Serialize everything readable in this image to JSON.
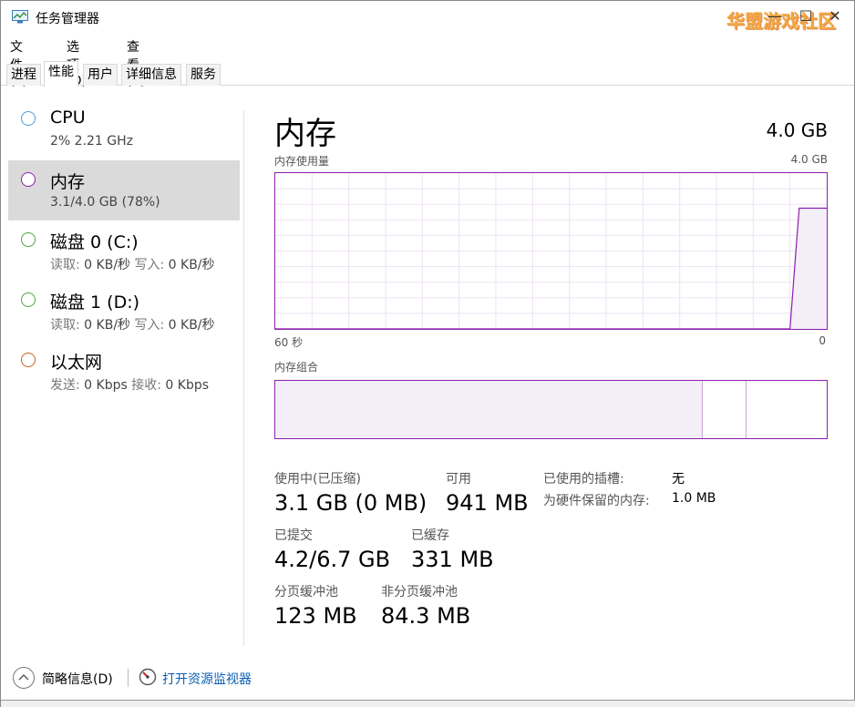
{
  "window": {
    "title": "任务管理器",
    "watermark": "华盟游戏社区",
    "controls": {
      "minimize": "—",
      "maximize": "☐",
      "close": "✕"
    }
  },
  "menu": [
    "文件(F)",
    "选项(O)",
    "查看(V)"
  ],
  "tabs": [
    {
      "label": "进程",
      "active": false
    },
    {
      "label": "性能",
      "active": true
    },
    {
      "label": "用户",
      "active": false
    },
    {
      "label": "详细信息",
      "active": false
    },
    {
      "label": "服务",
      "active": false
    }
  ],
  "resources": [
    {
      "name": "CPU",
      "sub": "2%  2.21 GHz",
      "color": "#4a9ad4",
      "selected": false
    },
    {
      "name": "内存",
      "sub": "3.1/4.0 GB (78%)",
      "color": "#8b1fae",
      "selected": true
    },
    {
      "name": "磁盘 0 (C:)",
      "sub_read_label": "读取:",
      "sub_read": "0 KB/秒",
      "sub_write_label": "写入:",
      "sub_write": "0 KB/秒",
      "color": "#4aa83a",
      "selected": false
    },
    {
      "name": "磁盘 1 (D:)",
      "sub_read_label": "读取:",
      "sub_read": "0 KB/秒",
      "sub_write_label": "写入:",
      "sub_write": "0 KB/秒",
      "color": "#4aa83a",
      "selected": false
    },
    {
      "name": "以太网",
      "sub_send_label": "发送:",
      "sub_send": "0 Kbps",
      "sub_recv_label": "接收:",
      "sub_recv": "0 Kbps",
      "color": "#c2621f",
      "selected": false
    }
  ],
  "main": {
    "title": "内存",
    "total": "4.0 GB",
    "usage_graph_label": "内存使用量",
    "usage_graph_max": "4.0 GB",
    "time_left": "60 秒",
    "time_right": "0",
    "composition_label": "内存组合",
    "accent_color": "#8b1fae",
    "stats": {
      "in_use_label": "使用中(已压缩)",
      "in_use_value": "3.1 GB (0 MB)",
      "available_label": "可用",
      "available_value": "941 MB",
      "committed_label": "已提交",
      "committed_value": "4.2/6.7 GB",
      "cached_label": "已缓存",
      "cached_value": "331 MB",
      "paged_label": "分页缓冲池",
      "paged_value": "123 MB",
      "nonpaged_label": "非分页缓冲池",
      "nonpaged_value": "84.3 MB",
      "slots_label": "已使用的插槽:",
      "slots_value": "无",
      "reserved_label": "为硬件保留的内存:",
      "reserved_value": "1.0 MB"
    }
  },
  "chart_data": {
    "type": "area",
    "title": "内存使用量",
    "ylabel": "",
    "xlabel": "",
    "x": [
      60,
      4,
      3,
      0
    ],
    "x_unit": "秒",
    "y_unit": "GB",
    "values": [
      0,
      0,
      3.1,
      3.1
    ],
    "ylim": [
      0,
      4.0
    ],
    "grid": true
  },
  "composition": {
    "in_use_fraction": 0.775,
    "modified_fraction": 0.08,
    "standby_fraction": 0.145
  },
  "footer": {
    "brief_label": "简略信息(D)",
    "resmon_label": "打开资源监视器"
  }
}
